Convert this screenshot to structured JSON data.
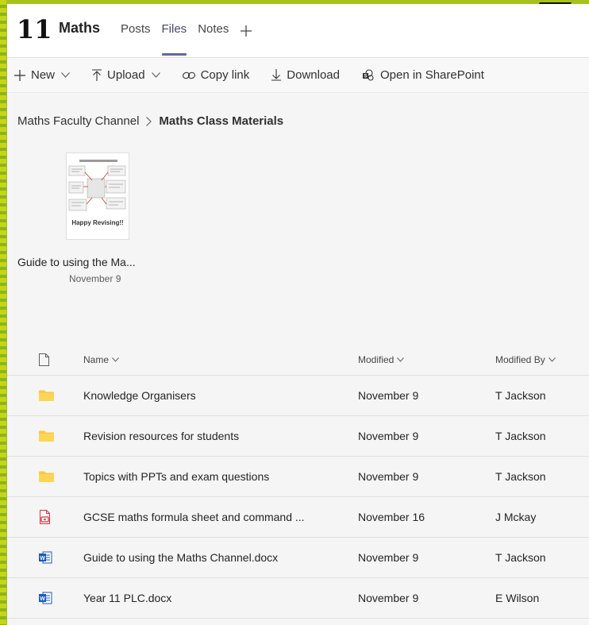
{
  "header": {
    "channel_number": "11",
    "title": "Maths",
    "tabs": [
      {
        "label": "Posts",
        "active": false
      },
      {
        "label": "Files",
        "active": true
      },
      {
        "label": "Notes",
        "active": false
      }
    ],
    "add_tab_icon": "plus-icon"
  },
  "toolbar": {
    "new_label": "New",
    "upload_label": "Upload",
    "copy_link_label": "Copy link",
    "download_label": "Download",
    "sharepoint_label": "Open in SharePoint"
  },
  "breadcrumb": {
    "parent": "Maths Faculty Channel",
    "current": "Maths Class Materials"
  },
  "featured_file": {
    "thumbnail_caption": "Happy Revising!!",
    "name": "Guide to using the Ma...",
    "date": "November 9"
  },
  "list": {
    "columns": {
      "name": "Name",
      "modified": "Modified",
      "modified_by": "Modified By"
    },
    "rows": [
      {
        "icon": "folder-icon",
        "name": "Knowledge Organisers",
        "modified": "November 9",
        "modified_by": "T Jackson"
      },
      {
        "icon": "folder-icon",
        "name": "Revision resources for students",
        "modified": "November 9",
        "modified_by": "T Jackson"
      },
      {
        "icon": "folder-icon",
        "name": "Topics with PPTs and exam questions",
        "modified": "November 9",
        "modified_by": "T Jackson"
      },
      {
        "icon": "pdf-icon",
        "name": "GCSE maths formula sheet and command ...",
        "modified": "November 16",
        "modified_by": "J Mckay"
      },
      {
        "icon": "word-doc-icon",
        "name": "Guide to using the Maths Channel.docx",
        "modified": "November 9",
        "modified_by": "T Jackson"
      },
      {
        "icon": "word-doc-icon",
        "name": "Year 11 PLC.docx",
        "modified": "November 9",
        "modified_by": "E Wilson"
      }
    ]
  },
  "colors": {
    "accent": "#6264a7",
    "folder": "#f8c843",
    "pdf": "#d13438",
    "word": "#185abd",
    "background_green": "#a6c21f"
  }
}
